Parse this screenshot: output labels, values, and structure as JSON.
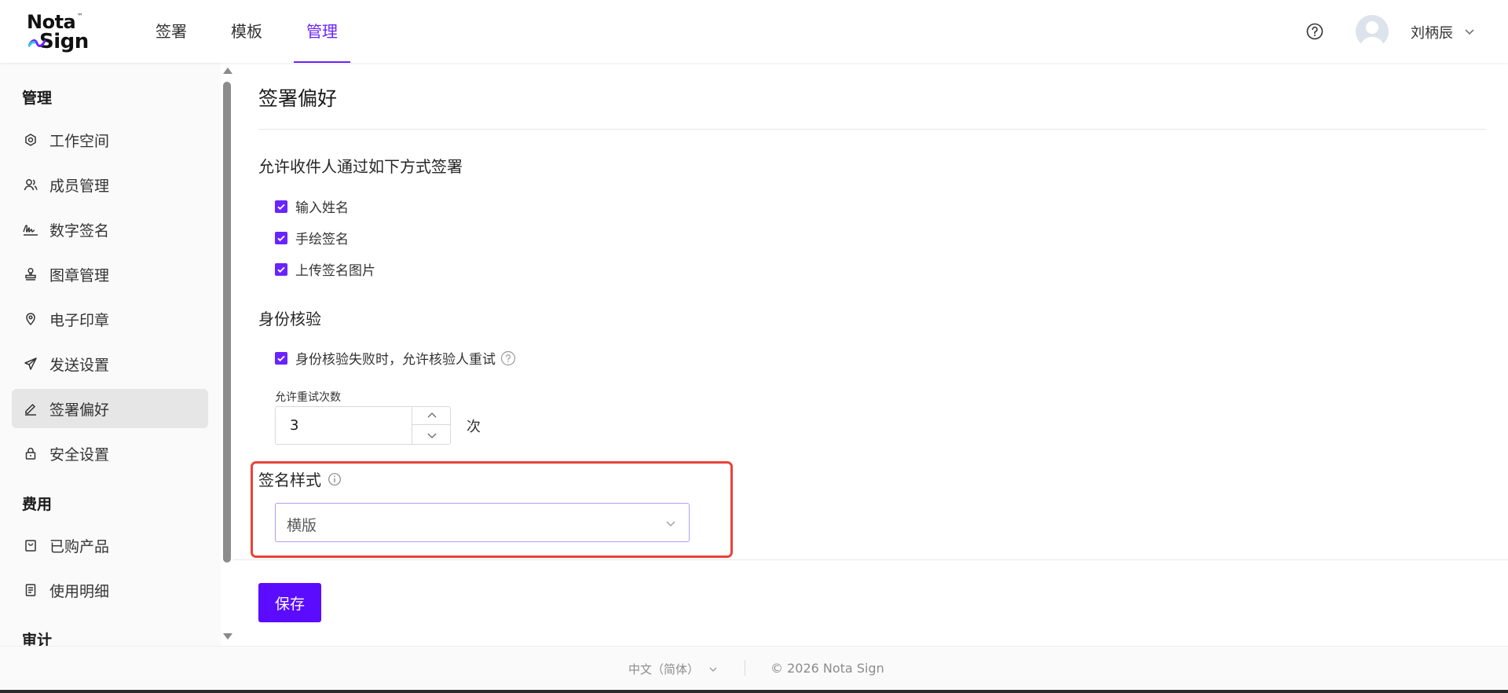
{
  "header": {
    "logo_line1": "Nota",
    "logo_line2": "Sign",
    "logo_tm": "™",
    "nav": [
      {
        "label": "签署"
      },
      {
        "label": "模板"
      },
      {
        "label": "管理",
        "active": true
      }
    ],
    "user_name": "刘柄辰"
  },
  "sidebar": {
    "sections": {
      "manage": "管理",
      "billing": "费用",
      "audit": "审计"
    },
    "items": [
      {
        "label": "工作空间",
        "icon": "workspace-icon"
      },
      {
        "label": "成员管理",
        "icon": "members-icon"
      },
      {
        "label": "数字签名",
        "icon": "signature-icon"
      },
      {
        "label": "图章管理",
        "icon": "stamp-icon"
      },
      {
        "label": "电子印章",
        "icon": "location-pin-icon"
      },
      {
        "label": "发送设置",
        "icon": "send-icon"
      },
      {
        "label": "签署偏好",
        "icon": "edit-pen-icon",
        "active": true
      },
      {
        "label": "安全设置",
        "icon": "lock-icon"
      },
      {
        "label": "已购产品",
        "icon": "bag-icon"
      },
      {
        "label": "使用明细",
        "icon": "document-icon"
      }
    ]
  },
  "main": {
    "title": "签署偏好",
    "sign_methods": {
      "label": "允许收件人通过如下方式签署",
      "options": [
        {
          "label": "输入姓名",
          "checked": true
        },
        {
          "label": "手绘签名",
          "checked": true
        },
        {
          "label": "上传签名图片",
          "checked": true
        }
      ]
    },
    "identity": {
      "label": "身份核验",
      "retry_option": "身份核验失败时，允许核验人重试",
      "retry_checked": true,
      "retry_count_label": "允许重试次数",
      "retry_count": "3",
      "retry_unit": "次"
    },
    "signature_style": {
      "label": "签名样式",
      "value": "横版"
    },
    "save_label": "保存"
  },
  "footer": {
    "language": "中文（简体）",
    "copyright": "© 2026 Nota Sign"
  },
  "colors": {
    "accent": "#6a24ff",
    "primary_button": "#5b0cff",
    "highlight": "#e8433a"
  }
}
